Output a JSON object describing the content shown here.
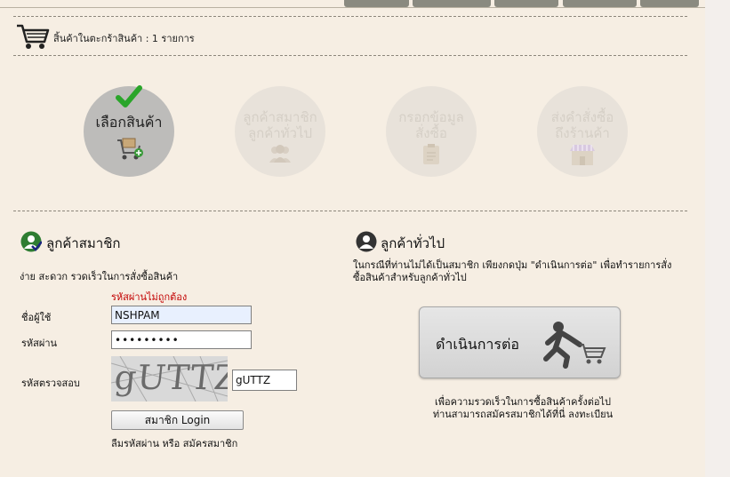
{
  "cart": {
    "count_text": "สิ้นค้าในตะกร้าสินค้า : 1 รายการ"
  },
  "steps": [
    {
      "line1": "เลือกสินค้า",
      "line2": ""
    },
    {
      "line1": "ลูกค้าสมาชิก",
      "line2": "ลูกค้าทั่วไป"
    },
    {
      "line1": "กรอกข้อมูล",
      "line2": "สั่งซื้อ"
    },
    {
      "line1": "ส่งคำสั่งซื้อ",
      "line2": "ถึงร้านค้า"
    }
  ],
  "member": {
    "title": "ลูกค้าสมาชิก",
    "description": "ง่าย สะดวก รวดเร็วในการสั่งซื้อสินค้า",
    "error": "รหัสผ่านไม่ถูกต้อง",
    "username_label": "ชื่อผู้ใช้",
    "username_value": "NSHPAM",
    "password_label": "รหัสผ่าน",
    "password_value": "•••••••••",
    "captcha_label": "รหัสตรวจสอบ",
    "captcha_text": "gUTTZ",
    "captcha_value": "gUTTZ",
    "login_label": "สมาชิก Login",
    "forgot_label": "ลืมรหัสผ่าน",
    "or_label": "หรือ",
    "register_label": "สมัครสมาชิก"
  },
  "guest": {
    "title": "ลูกค้าทั่วไป",
    "description_line1": "ในกรณีที่ท่านไม่ได้เป็นสมาชิก เพียงกดปุ่ม \"ดำเนินการต่อ\" เพื่อทำรายการสั่ง",
    "description_line2": "ซื้อสินค้าสำหรับลูกค้าทั่วไป",
    "proceed_label": "ดำเนินการต่อ",
    "note_line1": "เพื่อความรวดเร็วในการซื้อสินค้าครั้งต่อไป",
    "note_line2": "ท่านสามารถสมัครสมาชิกได้ที่นี่  ลงทะเบียน"
  },
  "colors": {
    "error": "#c20000",
    "page": "#f6eee3",
    "active_step": "#bdbcba",
    "check": "#2aa52a"
  }
}
